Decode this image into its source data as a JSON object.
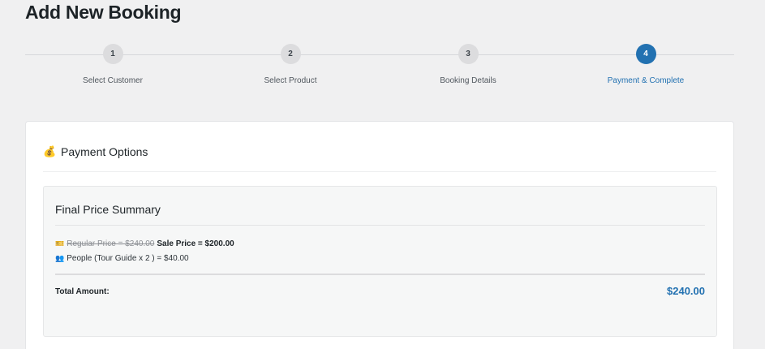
{
  "page": {
    "title": "Add New Booking"
  },
  "stepper": {
    "steps": [
      {
        "number": "1",
        "label": "Select Customer"
      },
      {
        "number": "2",
        "label": "Select Product"
      },
      {
        "number": "3",
        "label": "Booking Details"
      },
      {
        "number": "4",
        "label": "Payment & Complete"
      }
    ],
    "active_step": "4"
  },
  "payment": {
    "icon": "money-bag-icon",
    "icon_glyph": "💰",
    "title": "Payment Options"
  },
  "summary": {
    "title": "Final Price Summary",
    "lines": [
      {
        "icon": "ticket-icon",
        "icon_glyph": "🎫",
        "regular": "Regular Price = $240.00",
        "sale": "Sale Price = $200.00"
      },
      {
        "icon": "people-icon",
        "icon_glyph": "👥",
        "text": "People (Tour Guide x 2 ) = $40.00"
      }
    ],
    "total_label": "Total Amount:",
    "total_value": "$240.00"
  },
  "colors": {
    "accent": "#2271b1",
    "background": "#f0f0f1",
    "card": "#ffffff"
  }
}
